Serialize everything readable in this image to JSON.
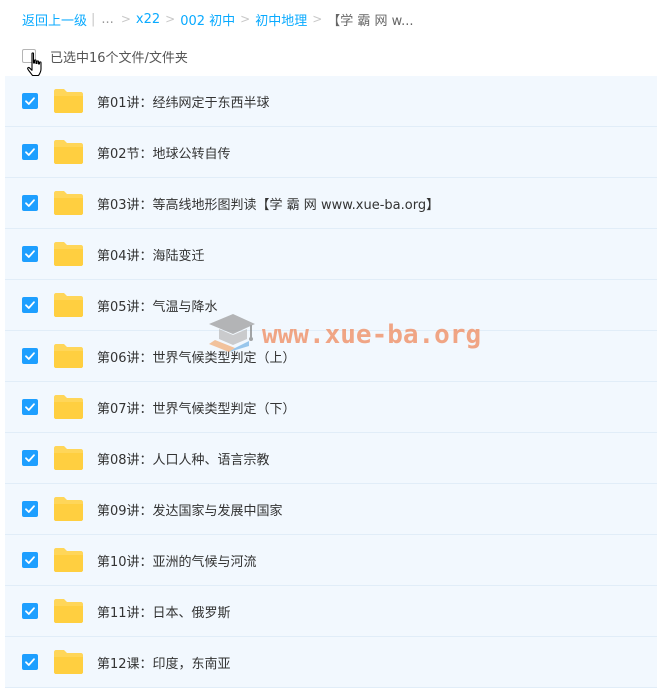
{
  "breadcrumb": {
    "back": "返回上一级",
    "ellipsis": "...",
    "sep": ">",
    "items": [
      "x22",
      "002 初中",
      "初中地理"
    ],
    "current": "【学 霸 网 w..."
  },
  "selection": {
    "label": "已选中16个文件/文件夹"
  },
  "files": [
    {
      "name": "第01讲：经纬网定于东西半球"
    },
    {
      "name": "第02节：地球公转自传"
    },
    {
      "name": "第03讲：等高线地形图判读【学 霸 网 www.xue-ba.org】"
    },
    {
      "name": "第04讲：海陆变迁"
    },
    {
      "name": "第05讲：气温与降水"
    },
    {
      "name": "第06讲：世界气候类型判定（上）"
    },
    {
      "name": "第07讲：世界气候类型判定（下）"
    },
    {
      "name": "第08讲：人口人种、语言宗教"
    },
    {
      "name": "第09讲：发达国家与发展中国家"
    },
    {
      "name": "第10讲：亚洲的气候与河流"
    },
    {
      "name": "第11讲：日本、俄罗斯"
    },
    {
      "name": "第12课：印度，东南亚"
    }
  ],
  "watermark": {
    "text": "www.xue-ba.org"
  },
  "colors": {
    "link": "#09aaff",
    "check": "#1e9fff",
    "folder": "#ffd659",
    "row_bg": "#f2f8fe",
    "watermark": "#f08a5d"
  },
  "icons": {
    "row_check": "checkbox-checked-icon",
    "folder": "folder-icon",
    "cursor": "hand-pointer-icon"
  }
}
